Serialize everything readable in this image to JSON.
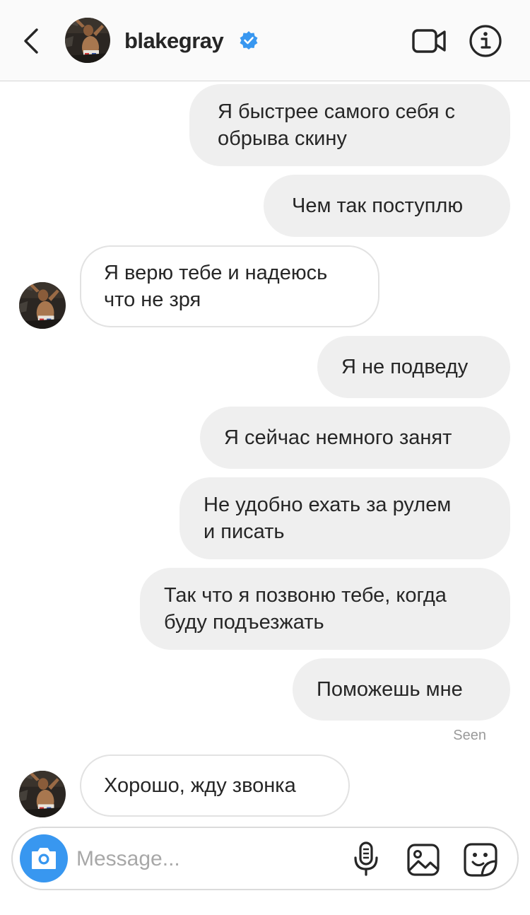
{
  "header": {
    "username": "blakegray",
    "verified_color": "#3897f0"
  },
  "messages": [
    {
      "direction": "out",
      "text": "Я быстрее самого себя с обрыва скину",
      "lines": [
        "Я быстрее самого себя с",
        "обрыва скину"
      ]
    },
    {
      "direction": "out",
      "text": "Чем так поступлю",
      "lines": [
        "Чем так поступлю"
      ]
    },
    {
      "direction": "in",
      "text": "Я верю тебе и надеюсь что не зря",
      "lines": [
        "Я верю тебе и надеюсь",
        "что не зря"
      ]
    },
    {
      "direction": "out",
      "text": "Я не подведу",
      "lines": [
        "Я не подведу"
      ]
    },
    {
      "direction": "out",
      "text": "Я сейчас немного занят",
      "lines": [
        "Я сейчас немного занят"
      ]
    },
    {
      "direction": "out",
      "text": "Не удобно ехать за рулем и писать",
      "lines": [
        "Не удобно ехать за рулем",
        "и писать"
      ]
    },
    {
      "direction": "out",
      "text": "Так что я позвоню тебе, когда буду подъезжать",
      "lines": [
        "Так что я позвоню тебе, когда",
        "буду подъезжать"
      ]
    },
    {
      "direction": "out",
      "text": "Поможешь мне",
      "lines": [
        "Поможешь мне"
      ]
    },
    {
      "direction": "in",
      "text": "Хорошо, жду звонка",
      "lines": [
        "Хорошо, жду звонка"
      ]
    }
  ],
  "seen_label": "Seen",
  "composer": {
    "placeholder": "Message...",
    "accent_color": "#3897f0"
  },
  "icons": {
    "back": "chevron-left-icon",
    "video": "video-camera-icon",
    "info": "info-icon",
    "camera": "camera-icon",
    "mic": "microphone-icon",
    "gallery": "gallery-icon",
    "sticker": "sticker-icon"
  }
}
